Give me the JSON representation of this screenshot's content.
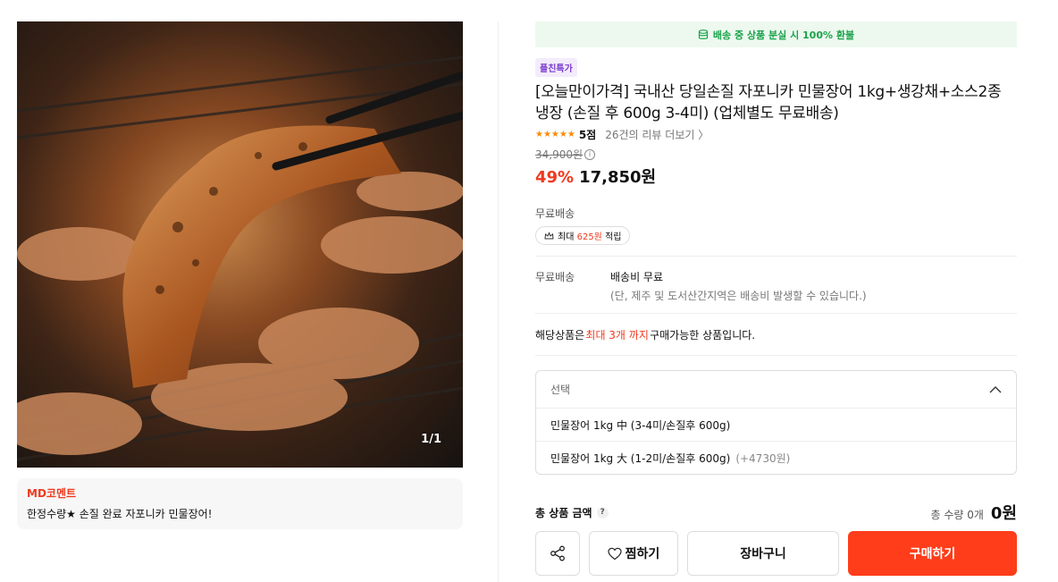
{
  "product_image": {
    "counter": "1/1"
  },
  "md_comment": {
    "title": "MD코멘트",
    "text": "한정수량★ 손질 완료 자포니카 민물장어!"
  },
  "refund_banner": {
    "text": "배송 중 상품 분실 시 100% 환불"
  },
  "badge": "플친특가",
  "title": "[오늘만이가격] 국내산 당일손질 자포니카 민물장어 1kg+생강채+소스2종 냉장 (손질 후 600g 3-4미) (업체별도 무료배송)",
  "rating": {
    "stars": "★★★★★",
    "score": "5점",
    "reviews": "26건의 리뷰 더보기 〉"
  },
  "price": {
    "original": "34,900원",
    "discount": "49%",
    "sale": "17,850원"
  },
  "shipping": {
    "label": "무료배송",
    "point_prefix": "최대 ",
    "point_amount": "625원",
    "point_suffix": " 적립",
    "detail_key": "무료배송",
    "detail_value": "배송비 무료",
    "detail_note": "(단, 제주 및 도서산간지역은 배송비 발생할 수 있습니다.)"
  },
  "limit": {
    "prefix": "해당상품은 ",
    "highlight": "최대 3개 까지",
    "suffix": " 구매가능한 상품입니다."
  },
  "options": {
    "head": "선택",
    "items": [
      {
        "label": "민물장어 1kg 中 (3-4미/손질후 600g)",
        "extra": ""
      },
      {
        "label": "민물장어 1kg 大 (1-2미/손질후 600g)",
        "extra": "(+4730원)"
      }
    ]
  },
  "total": {
    "label": "총 상품 금액",
    "qty": "총 수량 0개",
    "amount": "0원"
  },
  "buttons": {
    "like": "찜하기",
    "cart": "장바구니",
    "buy": "구매하기"
  },
  "colors": {
    "accent": "#ff3d1a",
    "sale_red": "#ef3a1f",
    "banner_green": "#1aa34a",
    "badge_purple": "#7a3bd0",
    "star_orange": "#ff8a00"
  }
}
